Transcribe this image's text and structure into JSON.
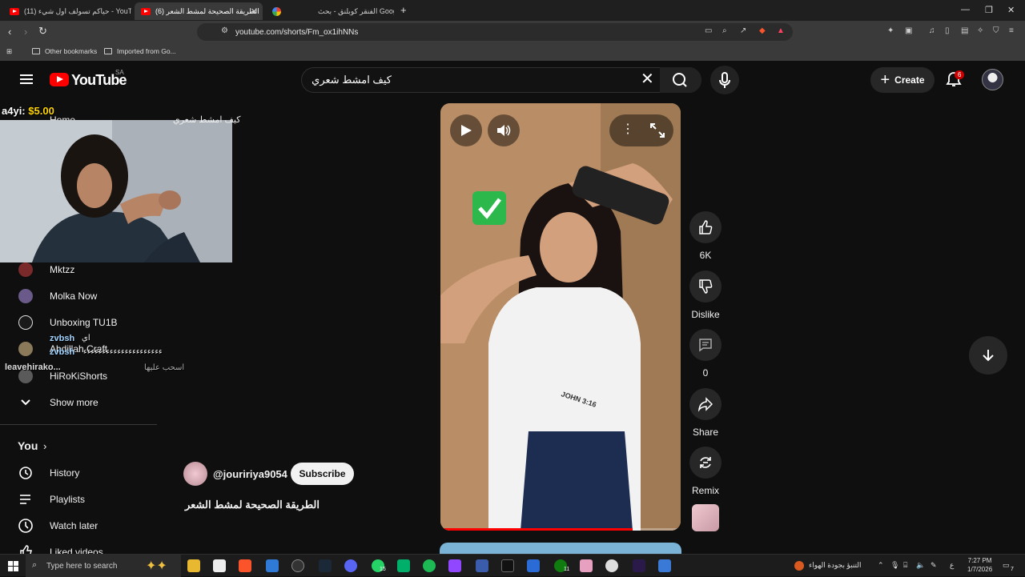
{
  "browser": {
    "tabs": [
      {
        "title": "(11) حياكم تسولف اول شيء - YouTube",
        "active": false,
        "icon": "youtube"
      },
      {
        "title": "(6) الطريقة الصحيحة لمشط الشعر",
        "active": true,
        "icon": "youtube"
      },
      {
        "title": "الفنقر كوبلنق - بحث Google",
        "active": false,
        "icon": "google"
      }
    ],
    "url": "youtube.com/shorts/Fm_ox1ihNNs",
    "bookmarks": [
      "Other bookmarks",
      "Imported from Go..."
    ]
  },
  "youtube": {
    "logo_text": "YouTube",
    "country_code": "SA",
    "search_query": "كيف امشط شعري",
    "create_label": "Create",
    "notification_count": "6"
  },
  "sidebar": {
    "home_label": "Home",
    "subscriptions": [
      {
        "name": "Mktzz",
        "color": "#7a2a2a"
      },
      {
        "name": "Molka Now",
        "color": "#6a5a8a"
      },
      {
        "name": "Unboxing TU1B",
        "color": "#444444"
      },
      {
        "name": "Abdillah Craft",
        "color": "#8a7a5a"
      },
      {
        "name": "HiRoKiShorts",
        "color": "#5a5a5a"
      }
    ],
    "show_more": "Show more",
    "you_label": "You",
    "you_items": [
      {
        "label": "History",
        "icon": "history-icon"
      },
      {
        "label": "Playlists",
        "icon": "playlists-icon"
      },
      {
        "label": "Watch later",
        "icon": "watch-later-icon"
      },
      {
        "label": "Liked videos",
        "icon": "liked-videos-icon"
      }
    ]
  },
  "overlay": {
    "donation_name": "a4yi:",
    "donation_amount": "$5.00",
    "chat": [
      {
        "name": "zvbsh",
        "message": "اي"
      },
      {
        "name": "zvbsh",
        "message": "ءءءءءءءءءءءءءءءءءءءءء"
      },
      {
        "name": "leavehirako...",
        "message": "اسحب عليها"
      }
    ],
    "back_text": "كيف امشط شعري"
  },
  "short": {
    "channel": "@jouririya9054",
    "subscribe_label": "Subscribe",
    "title": "الطريقة الصحيحة لمشط الشعر",
    "progress": 0.8,
    "shirt_text": "JOHN 3:16",
    "actions": {
      "likes": "6K",
      "dislike": "Dislike",
      "comments": "0",
      "share": "Share",
      "remix": "Remix"
    }
  },
  "taskbar": {
    "search_placeholder": "Type here to search",
    "weather": "التنبؤ بجودة الهواء",
    "lang": "ع",
    "time": "7:27 PM",
    "date": "1/7/2026",
    "whatsapp_badge": "15",
    "xbox_badge": "11",
    "notif_badge": "7"
  }
}
